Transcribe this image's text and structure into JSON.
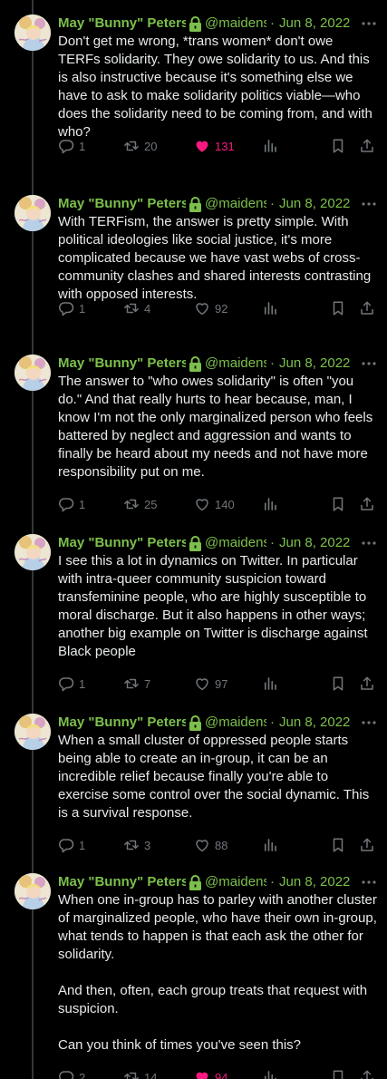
{
  "author": {
    "name": "May \"Bunny\" Peters",
    "handle": "@maidens",
    "protected_icon": "lock-icon",
    "avatar": "avatar-art"
  },
  "colors": {
    "name": "#7cc04b",
    "like_active": "#f91880",
    "muted": "#71767b",
    "text": "#e7e9ea"
  },
  "tweets": [
    {
      "date": "Jun 8, 2022",
      "paragraphs": [
        "Don't get me wrong, *trans women* don't owe TERFs solidarity. They owe solidarity to us. And this is also instructive because it's something else we have to ask to make solidarity politics viable—who does the solidarity need to be coming from, and with who?"
      ],
      "replies": "1",
      "retweets": "20",
      "likes": "131",
      "liked": true
    },
    {
      "date": "Jun 8, 2022",
      "paragraphs": [
        "With TERFism, the answer is pretty simple. With political ideologies like social justice, it's more complicated because we have vast webs of cross-community clashes and shared interests contrasting with opposed interests."
      ],
      "replies": "1",
      "retweets": "4",
      "likes": "92",
      "liked": false
    },
    {
      "date": "Jun 8, 2022",
      "paragraphs": [
        "The answer to \"who owes solidarity\" is often \"you do.\" And that really hurts to hear because, man, I know I'm not the only marginalized person who feels battered by neglect and aggression and wants to finally be heard about my needs and not have more responsibility put on me."
      ],
      "replies": "1",
      "retweets": "25",
      "likes": "140",
      "liked": false
    },
    {
      "date": "Jun 8, 2022",
      "paragraphs": [
        "I see this a lot in dynamics on Twitter. In particular with intra-queer community suspicion toward transfeminine people, who are highly susceptible to moral discharge. But it also happens in other ways; another big example on Twitter is discharge against Black people"
      ],
      "replies": "1",
      "retweets": "7",
      "likes": "97",
      "liked": false
    },
    {
      "date": "Jun 8, 2022",
      "paragraphs": [
        "When a small cluster of oppressed people starts being able to create an in-group, it can be an incredible relief because finally you're able to exercise some control over the social dynamic. This is a survival response."
      ],
      "replies": "1",
      "retweets": "3",
      "likes": "88",
      "liked": false
    },
    {
      "date": "Jun 8, 2022",
      "paragraphs": [
        "When one in-group has to parley with another cluster of marginalized people, who have their own in-group, what tends to happen is that each ask the other for solidarity.",
        "And then, often, each group treats that request with suspicion.",
        "Can you think of times you've seen this?"
      ],
      "replies": "2",
      "retweets": "14",
      "likes": "94",
      "liked": true
    }
  ]
}
